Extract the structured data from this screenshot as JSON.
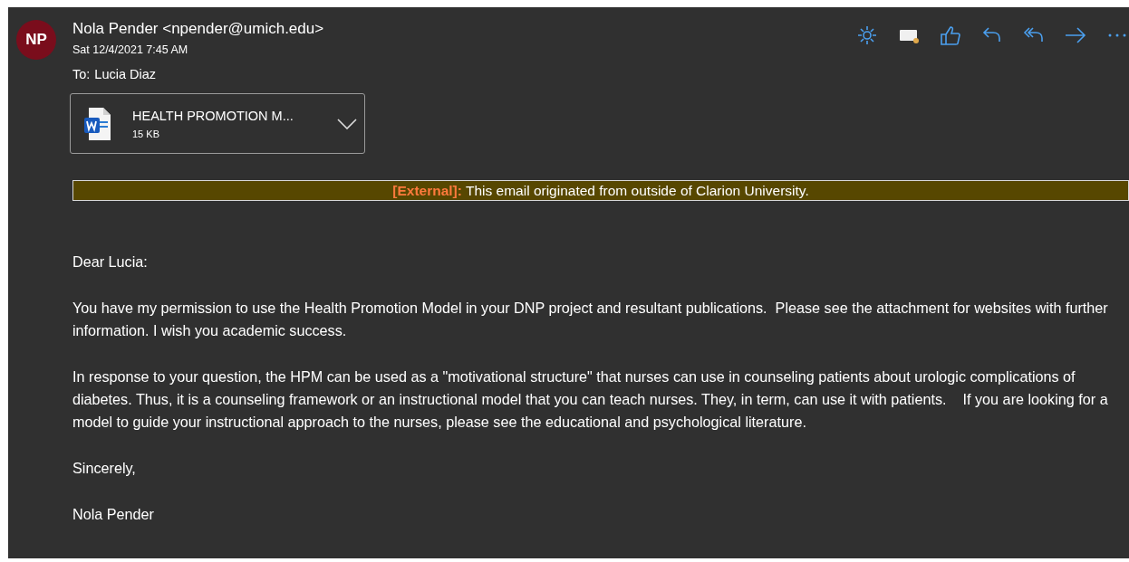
{
  "message": {
    "avatar": "NP",
    "sender": "Nola Pender <npender@umich.edu>",
    "date": "Sat 12/4/2021 7:45 AM",
    "to_label": "To:",
    "to": "Lucia Diaz"
  },
  "toolbar": [
    {
      "kind": "sun"
    },
    {
      "kind": "tag"
    },
    {
      "kind": "like"
    },
    {
      "kind": "reply"
    },
    {
      "kind": "reply-all"
    },
    {
      "kind": "forward"
    },
    {
      "kind": "more"
    }
  ],
  "attachment": {
    "name": "HEALTH PROMOTION M...",
    "size": "15 KB"
  },
  "banner": "**[External]:** This email originated from outside of Clarion University.",
  "body": [
    "Dear Lucia:",
    "You have my permission to use the Health Promotion Model in your DNP project and resultant publications.  Please see the attachment for websites with further information. I wish you academic success.",
    "In response to your question, the HPM can be used as a \"motivational structure\" that nurses can use in counseling patients about urologic complications of diabetes. Thus, it is a counseling framework or an instructional model that you can teach nurses. They, in term, can use it with patients.    If you are looking for a model to guide your instructional approach to the nurses, please see the educational and psychological literature.",
    "Sincerely,",
    "Nola Pender"
  ]
}
